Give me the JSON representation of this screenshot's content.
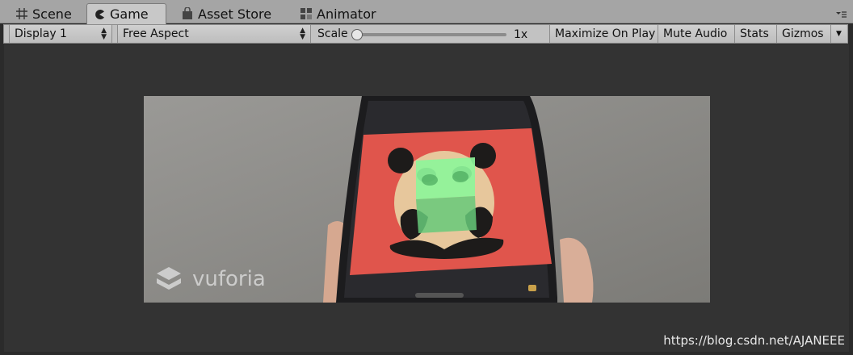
{
  "tabs": [
    {
      "label": "Scene",
      "icon": "grid-icon",
      "active": false
    },
    {
      "label": "Game",
      "icon": "pacman-icon",
      "active": true
    },
    {
      "label": "Asset Store",
      "icon": "bag-icon",
      "active": false
    },
    {
      "label": "Animator",
      "icon": "animator-icon",
      "active": false
    }
  ],
  "toolbar": {
    "display": "Display 1",
    "aspect": "Free Aspect",
    "scale_label": "Scale",
    "scale_value": "1x",
    "scale_level": 0.0,
    "maximize": "Maximize On Play",
    "mute": "Mute Audio",
    "stats": "Stats",
    "gizmos": "Gizmos"
  },
  "game_view": {
    "overlay_brand": "vuforia",
    "watermark": "https://blog.csdn.net/AJANEEE"
  },
  "colors": {
    "tab_bar": "#a5a5a5",
    "toolbar": "#c2c2c2",
    "game_bg": "#333333",
    "target_red": "#e0554c",
    "cube_green": "#7ef08e"
  }
}
